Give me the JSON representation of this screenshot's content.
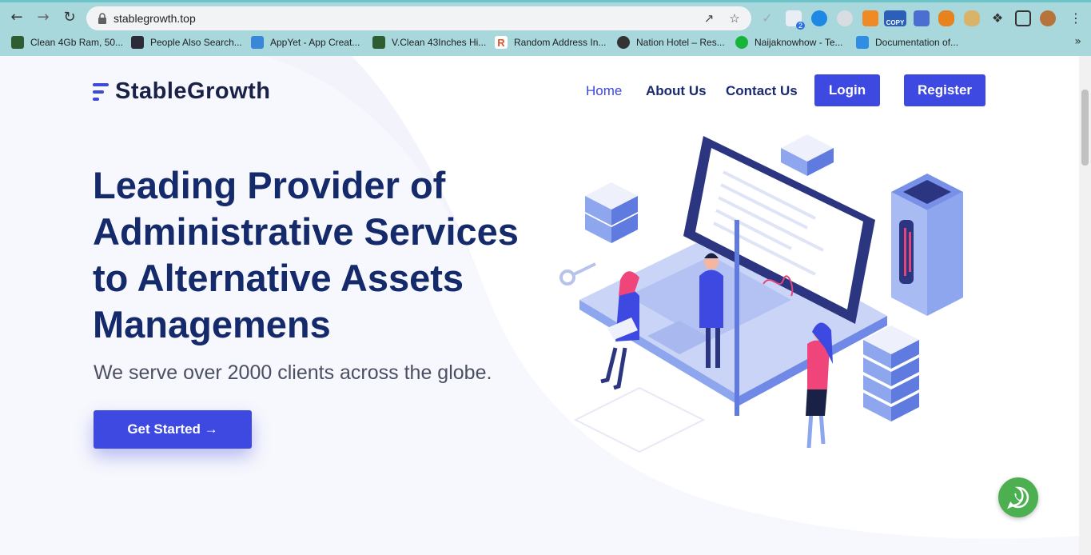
{
  "browser": {
    "url": "stablegrowth.top",
    "bookmarks": [
      {
        "label": "Clean 4Gb Ram, 50...",
        "color": "#2e5d32"
      },
      {
        "label": "People Also Search...",
        "color": "#2b2b3a"
      },
      {
        "label": "AppYet - App Creat...",
        "color": "#3a86d8"
      },
      {
        "label": "V.Clean 43Inches Hi...",
        "color": "#2e5d32"
      },
      {
        "label": "Random Address In...",
        "color": "#e0532b"
      },
      {
        "label": "Nation Hotel – Res...",
        "color": "#333333"
      },
      {
        "label": "Naijaknowhow - Te...",
        "color": "#17b33a"
      },
      {
        "label": "Documentation of...",
        "color": "#2f8de4"
      }
    ],
    "extension_badge": "2",
    "copy_badge": "COPY"
  },
  "site": {
    "logo": "StableGrowth",
    "nav": {
      "home": "Home",
      "about": "About Us",
      "contact": "Contact Us",
      "login": "Login",
      "register": "Register"
    },
    "hero": {
      "title_line1": "Leading Provider of",
      "title_line2": "Administrative Services",
      "title_line3": "to Alternative Assets",
      "title_line4": "Managemens",
      "subtitle": "We serve over 2000 clients across the globe.",
      "cta": "Get Started →"
    }
  },
  "colors": {
    "primary": "#3e49e2",
    "heading": "#152a6b",
    "whatsapp": "#4caf50"
  }
}
